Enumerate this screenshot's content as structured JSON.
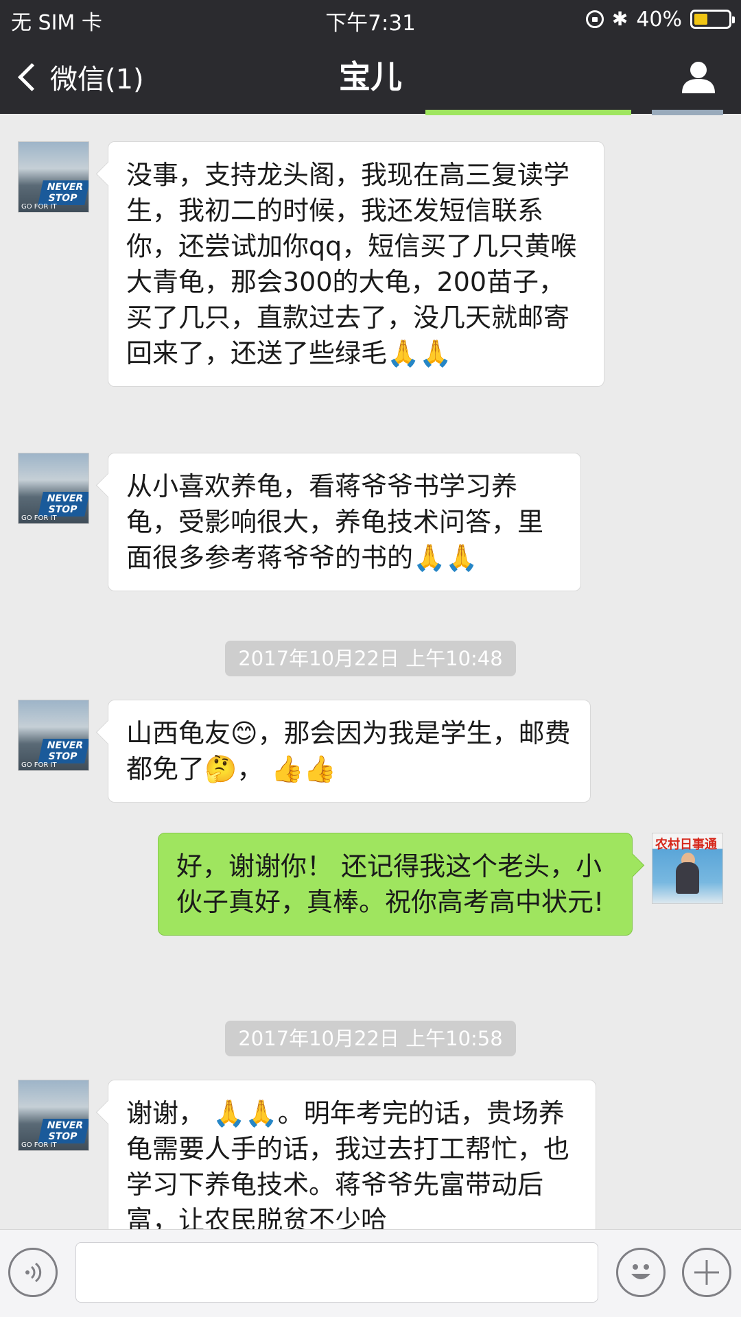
{
  "status_bar": {
    "carrier": "无 SIM 卡",
    "time": "下午7:31",
    "battery_text": "40%",
    "battery_level": 0.4
  },
  "nav": {
    "back_label": "微信(1)",
    "title": "宝儿"
  },
  "icons": {
    "back": "chevron-left-icon",
    "profile": "person-icon",
    "voice": "voice-icon",
    "emoji": "emoji-icon",
    "add": "plus-icon",
    "lock": "orientation-lock-icon",
    "bluetooth": "bluetooth-icon"
  },
  "colors": {
    "nav_bg": "#2b2b2f",
    "chat_bg": "#ebebeb",
    "bubble_self": "#9fe55f",
    "bubble_other": "#ffffff",
    "timestamp_bg": "#cecece"
  },
  "avatar": {
    "badge_text": "NEVER STOP",
    "badge_text2": "GO FOR IT"
  },
  "self_avatar": {
    "magazine_text": "农村日事通"
  },
  "messages": [
    {
      "side": "left",
      "text": "没事，支持龙头阁，我现在高三复读学生，我初二的时候，我还发短信联系你，还尝试加你qq，短信买了几只黄喉大青龟，那会300的大龟，200苗子，买了几只，直款过去了，没几天就邮寄回来了，还送了些绿毛🙏🙏"
    },
    {
      "side": "left",
      "text": "从小喜欢养龟，看蒋爷爷书学习养龟，受影响很大，养龟技术问答，里面很多参考蒋爷爷的书的🙏🙏"
    },
    {
      "timestamp": "2017年10月22日 上午10:48"
    },
    {
      "side": "left",
      "text": "山西龟友😊，那会因为我是学生，邮费都免了🤔， 👍👍"
    },
    {
      "side": "right",
      "text": "好，谢谢你！ 还记得我这个老头，小伙子真好，真棒。祝你高考高中状元!"
    },
    {
      "timestamp": "2017年10月22日 上午10:58"
    },
    {
      "side": "left",
      "text": "谢谢， 🙏🙏。明年考完的话，贵场养龟需要人手的话，我过去打工帮忙，也学习下养龟技术。蒋爷爷先富带动后富，让农民脱贫不少哈"
    }
  ]
}
